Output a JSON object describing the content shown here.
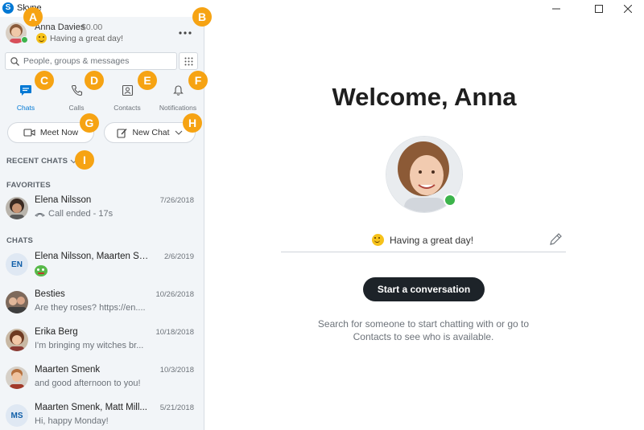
{
  "window": {
    "title": "Skype",
    "app_icon_letter": "S"
  },
  "profile": {
    "name": "Anna Davies",
    "credit": "$0.00",
    "mood": "Having a great day!"
  },
  "search": {
    "placeholder": "People, groups & messages"
  },
  "nav_tabs": [
    {
      "label": "Chats",
      "active": true
    },
    {
      "label": "Calls",
      "active": false
    },
    {
      "label": "Contacts",
      "active": false
    },
    {
      "label": "Notifications",
      "active": false
    }
  ],
  "actions": {
    "meet_now": "Meet Now",
    "new_chat": "New Chat"
  },
  "sections": {
    "recent": "RECENT CHATS",
    "favorites": "FAVORITES",
    "chats": "CHATS"
  },
  "favorites": [
    {
      "name": "Elena Nilsson",
      "date": "7/26/2018",
      "preview": "Call ended - 17s"
    }
  ],
  "chats": [
    {
      "name": "Elena Nilsson, Maarten Sm...",
      "date": "2/6/2019",
      "initials": "EN"
    },
    {
      "name": "Besties",
      "date": "10/26/2018",
      "preview": "Are they roses?  https://en...."
    },
    {
      "name": "Erika Berg",
      "date": "10/18/2018",
      "preview": "I'm bringing my witches br..."
    },
    {
      "name": "Maarten Smenk",
      "date": "10/3/2018",
      "preview": "and good afternoon to you!"
    },
    {
      "name": "Maarten Smenk, Matt Mill...",
      "date": "5/21/2018",
      "preview": "Hi, happy Monday!",
      "initials": "MS"
    }
  ],
  "main": {
    "welcome": "Welcome, Anna",
    "mood": "Having a great day!",
    "start_button": "Start a conversation",
    "hint": "Search for someone to start chatting with or go to Contacts to see who is available."
  },
  "callouts": [
    "A",
    "B",
    "C",
    "D",
    "E",
    "F",
    "G",
    "H",
    "I"
  ],
  "colors": {
    "accent": "#0078d4",
    "callout": "#f6a313",
    "presence": "#3cb44b",
    "sidebar_bg": "#f2f5f8",
    "dark_button": "#1d2329"
  }
}
